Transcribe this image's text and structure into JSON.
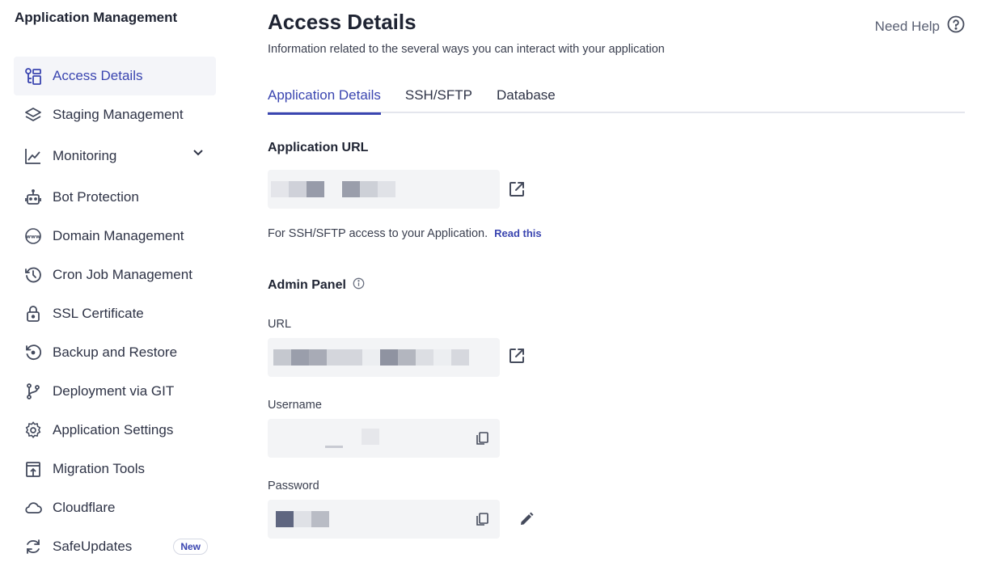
{
  "sidebar": {
    "title": "Application Management",
    "items": [
      {
        "label": "Access Details"
      },
      {
        "label": "Staging Management"
      },
      {
        "label": "Monitoring"
      },
      {
        "label": "Bot Protection"
      },
      {
        "label": "Domain Management"
      },
      {
        "label": "Cron Job Management"
      },
      {
        "label": "SSL Certificate"
      },
      {
        "label": "Backup and Restore"
      },
      {
        "label": "Deployment via GIT"
      },
      {
        "label": "Application Settings"
      },
      {
        "label": "Migration Tools"
      },
      {
        "label": "Cloudflare"
      },
      {
        "label": "SafeUpdates",
        "badge": "New"
      }
    ]
  },
  "header": {
    "title": "Access Details",
    "subtitle": "Information related to the several ways you can interact with your application",
    "help_label": "Need Help"
  },
  "tabs": [
    {
      "label": "Application Details",
      "active": true
    },
    {
      "label": "SSH/SFTP",
      "active": false
    },
    {
      "label": "Database",
      "active": false
    }
  ],
  "app_url": {
    "title": "Application URL"
  },
  "ssh_note": {
    "text": "For SSH/SFTP access to your Application.",
    "link": "Read this"
  },
  "admin_panel": {
    "title": "Admin Panel",
    "url_label": "URL",
    "username_label": "Username",
    "password_label": "Password"
  },
  "colors": {
    "accent": "#3a45b0",
    "field_bg": "#f3f4f6",
    "active_nav_bg": "#f4f5f9"
  }
}
